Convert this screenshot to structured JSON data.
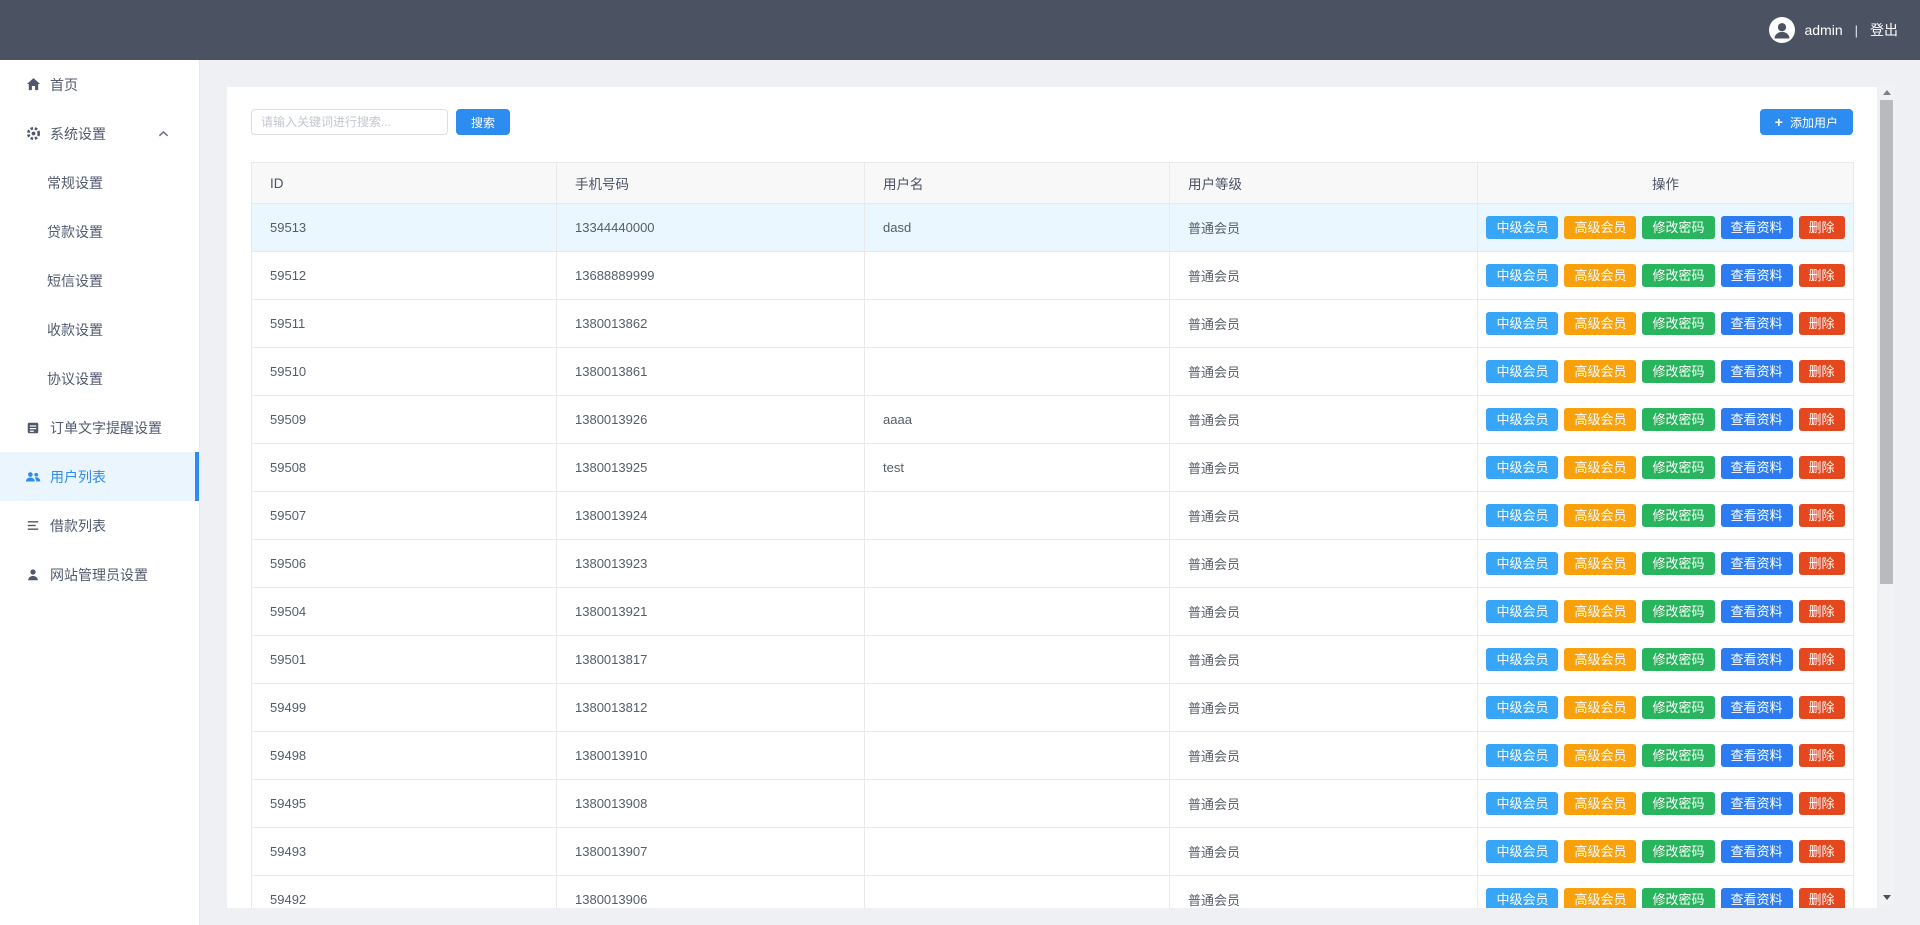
{
  "header": {
    "username": "admin",
    "separator": "|",
    "logout_label": "登出",
    "bg_color": "#4b5362"
  },
  "sidebar": {
    "active_color": "#2d8cf0",
    "items": [
      {
        "label": "首页",
        "icon": "home-icon",
        "type": "item"
      },
      {
        "label": "系统设置",
        "icon": "gear-icon",
        "type": "item",
        "expanded": true
      },
      {
        "label": "常规设置",
        "type": "sub"
      },
      {
        "label": "贷款设置",
        "type": "sub"
      },
      {
        "label": "短信设置",
        "type": "sub"
      },
      {
        "label": "收款设置",
        "type": "sub"
      },
      {
        "label": "协议设置",
        "type": "sub"
      },
      {
        "label": "订单文字提醒设置",
        "icon": "order-text-icon",
        "type": "item"
      },
      {
        "label": "用户列表",
        "icon": "users-icon",
        "type": "item",
        "active": true
      },
      {
        "label": "借款列表",
        "icon": "list-icon",
        "type": "item"
      },
      {
        "label": "网站管理员设置",
        "icon": "admin-icon",
        "type": "item"
      }
    ]
  },
  "toolbar": {
    "search_placeholder": "请输入关键词进行搜索...",
    "search_button": "搜索",
    "add_user_plus": "+",
    "add_user_button": "添加用户",
    "button_color": "#2d8cf0"
  },
  "table": {
    "columns": [
      "ID",
      "手机号码",
      "用户名",
      "用户等级",
      "操作"
    ],
    "row_actions": [
      {
        "label": "中级会员",
        "color": "#38a6f6",
        "name": "mid-member-button"
      },
      {
        "label": "高级会员",
        "color": "#f9a10c",
        "name": "senior-member-button"
      },
      {
        "label": "修改密码",
        "color": "#28b55d",
        "name": "change-password-button"
      },
      {
        "label": "查看资料",
        "color": "#2d7bf0",
        "name": "view-profile-button"
      },
      {
        "label": "删除",
        "color": "#e5471f",
        "name": "delete-button"
      }
    ],
    "rows": [
      {
        "id": "59513",
        "phone": "13344440000",
        "username": "dasd",
        "level": "普通会员",
        "highlighted": true
      },
      {
        "id": "59512",
        "phone": "13688889999",
        "username": "",
        "level": "普通会员"
      },
      {
        "id": "59511",
        "phone": "1380013862",
        "username": "",
        "level": "普通会员"
      },
      {
        "id": "59510",
        "phone": "1380013861",
        "username": "",
        "level": "普通会员"
      },
      {
        "id": "59509",
        "phone": "1380013926",
        "username": "aaaa",
        "level": "普通会员"
      },
      {
        "id": "59508",
        "phone": "1380013925",
        "username": "test",
        "level": "普通会员"
      },
      {
        "id": "59507",
        "phone": "1380013924",
        "username": "",
        "level": "普通会员"
      },
      {
        "id": "59506",
        "phone": "1380013923",
        "username": "",
        "level": "普通会员"
      },
      {
        "id": "59504",
        "phone": "1380013921",
        "username": "",
        "level": "普通会员"
      },
      {
        "id": "59501",
        "phone": "1380013817",
        "username": "",
        "level": "普通会员"
      },
      {
        "id": "59499",
        "phone": "1380013812",
        "username": "",
        "level": "普通会员"
      },
      {
        "id": "59498",
        "phone": "1380013910",
        "username": "",
        "level": "普通会员"
      },
      {
        "id": "59495",
        "phone": "1380013908",
        "username": "",
        "level": "普通会员"
      },
      {
        "id": "59493",
        "phone": "1380013907",
        "username": "",
        "level": "普通会员"
      },
      {
        "id": "59492",
        "phone": "1380013906",
        "username": "",
        "level": "普通会员"
      }
    ]
  }
}
